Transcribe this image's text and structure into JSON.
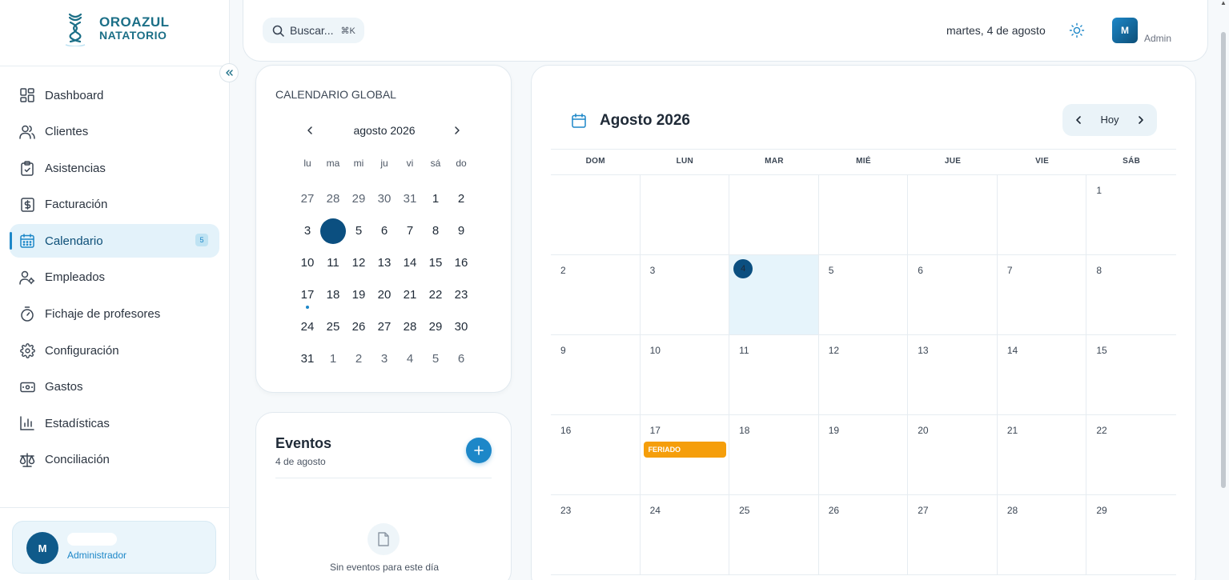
{
  "brand": {
    "line1": "OROAZUL",
    "line2": "NATATORIO"
  },
  "sidebar": {
    "items": [
      {
        "label": "Dashboard",
        "icon": "dashboard-icon"
      },
      {
        "label": "Clientes",
        "icon": "users-icon"
      },
      {
        "label": "Asistencias",
        "icon": "clipboard-check-icon"
      },
      {
        "label": "Facturación",
        "icon": "receipt-dollar-icon"
      },
      {
        "label": "Calendario",
        "icon": "calendar-icon",
        "active": true,
        "badge": "5"
      },
      {
        "label": "Empleados",
        "icon": "user-cog-icon"
      },
      {
        "label": "Fichaje de profesores",
        "icon": "timer-icon"
      },
      {
        "label": "Configuración",
        "icon": "gear-icon"
      },
      {
        "label": "Gastos",
        "icon": "banknote-icon"
      },
      {
        "label": "Estadísticas",
        "icon": "bar-chart-icon"
      },
      {
        "label": "Conciliación",
        "icon": "scale-icon"
      }
    ],
    "user": {
      "initial": "M",
      "role": "Administrador"
    }
  },
  "header": {
    "search_label": "Buscar...",
    "search_shortcut": "⌘K",
    "date": "martes, 4 de agosto",
    "admin_initial": "M",
    "admin_label": "Admin"
  },
  "mini_calendar": {
    "title": "CALENDARIO GLOBAL",
    "month": "agosto 2026",
    "weekdays": [
      "lu",
      "ma",
      "mi",
      "ju",
      "vi",
      "sá",
      "do"
    ],
    "weeks": [
      [
        {
          "d": "27",
          "m": true
        },
        {
          "d": "28",
          "m": true
        },
        {
          "d": "29",
          "m": true
        },
        {
          "d": "30",
          "m": true
        },
        {
          "d": "31",
          "m": true
        },
        {
          "d": "1"
        },
        {
          "d": "2"
        }
      ],
      [
        {
          "d": "3"
        },
        {
          "d": "4",
          "sel": true
        },
        {
          "d": "5"
        },
        {
          "d": "6"
        },
        {
          "d": "7"
        },
        {
          "d": "8"
        },
        {
          "d": "9"
        }
      ],
      [
        {
          "d": "10"
        },
        {
          "d": "11"
        },
        {
          "d": "12"
        },
        {
          "d": "13"
        },
        {
          "d": "14"
        },
        {
          "d": "15"
        },
        {
          "d": "16"
        }
      ],
      [
        {
          "d": "17",
          "ev": true
        },
        {
          "d": "18"
        },
        {
          "d": "19"
        },
        {
          "d": "20"
        },
        {
          "d": "21"
        },
        {
          "d": "22"
        },
        {
          "d": "23"
        }
      ],
      [
        {
          "d": "24"
        },
        {
          "d": "25"
        },
        {
          "d": "26"
        },
        {
          "d": "27"
        },
        {
          "d": "28"
        },
        {
          "d": "29"
        },
        {
          "d": "30"
        }
      ],
      [
        {
          "d": "31"
        },
        {
          "d": "1",
          "m": true
        },
        {
          "d": "2",
          "m": true
        },
        {
          "d": "3",
          "m": true
        },
        {
          "d": "4",
          "m": true
        },
        {
          "d": "5",
          "m": true
        },
        {
          "d": "6",
          "m": true
        }
      ]
    ]
  },
  "events_panel": {
    "title": "Eventos",
    "date": "4 de agosto",
    "empty_text": "Sin eventos para este día"
  },
  "calendar": {
    "title": "Agosto 2026",
    "today_label": "Hoy",
    "weekdays": [
      "DOM",
      "LUN",
      "MAR",
      "MIÉ",
      "JUE",
      "VIE",
      "SÁB"
    ],
    "weeks": [
      [
        {
          "d": ""
        },
        {
          "d": ""
        },
        {
          "d": ""
        },
        {
          "d": ""
        },
        {
          "d": ""
        },
        {
          "d": ""
        },
        {
          "d": "1"
        }
      ],
      [
        {
          "d": "2"
        },
        {
          "d": "3"
        },
        {
          "d": "4",
          "today": true
        },
        {
          "d": "5"
        },
        {
          "d": "6"
        },
        {
          "d": "7"
        },
        {
          "d": "8"
        }
      ],
      [
        {
          "d": "9"
        },
        {
          "d": "10"
        },
        {
          "d": "11"
        },
        {
          "d": "12"
        },
        {
          "d": "13"
        },
        {
          "d": "14"
        },
        {
          "d": "15"
        }
      ],
      [
        {
          "d": "16"
        },
        {
          "d": "17",
          "event": "FERIADO"
        },
        {
          "d": "18"
        },
        {
          "d": "19"
        },
        {
          "d": "20"
        },
        {
          "d": "21"
        },
        {
          "d": "22"
        }
      ],
      [
        {
          "d": "23"
        },
        {
          "d": "24"
        },
        {
          "d": "25"
        },
        {
          "d": "26"
        },
        {
          "d": "27"
        },
        {
          "d": "28"
        },
        {
          "d": "29"
        }
      ]
    ]
  },
  "colors": {
    "accent": "#1d87c8",
    "brand": "#1b6f87",
    "selected": "#0b4f80",
    "holiday": "#f59e0b"
  }
}
